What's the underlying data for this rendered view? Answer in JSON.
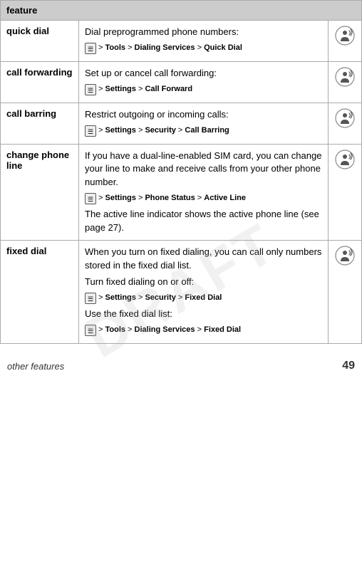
{
  "table": {
    "header": "feature",
    "rows": [
      {
        "feature": "quick dial",
        "description_text": "Dial preprogrammed phone numbers:",
        "menu_lines": [
          {
            "path": "> Tools > Dialing Services > Quick Dial"
          }
        ],
        "note": "",
        "has_icon": true
      },
      {
        "feature": "call forwarding",
        "description_text": "Set up or cancel call forwarding:",
        "menu_lines": [
          {
            "path": "> Settings > Call Forward"
          }
        ],
        "note": "",
        "has_icon": true
      },
      {
        "feature": "call barring",
        "description_text": "Restrict outgoing or incoming calls:",
        "menu_lines": [
          {
            "path": "> Settings > Security > Call Barring"
          }
        ],
        "note": "",
        "has_icon": true
      },
      {
        "feature": "change phone line",
        "description_text": "If you have a dual-line-enabled SIM card, you can change your line to make and receive calls from your other phone number.",
        "menu_lines": [
          {
            "path": "> Settings > Phone Status > Active Line"
          }
        ],
        "note": "The active line indicator shows the active phone line (see page 27).",
        "has_icon": true
      },
      {
        "feature": "fixed dial",
        "description_text": "When you turn on fixed dialing, you can call only numbers stored in the fixed dial list.",
        "menu_lines": [
          {
            "prefix": "Turn fixed dialing on or off:",
            "path": "> Settings > Security > Fixed Dial"
          },
          {
            "prefix": "Use the fixed dial list:",
            "path": "> Tools > Dialing Services > Fixed Dial"
          }
        ],
        "note": "",
        "has_icon": true
      }
    ]
  },
  "footer": {
    "left_text": "other features",
    "right_text": "49"
  },
  "watermark": "DRAFT"
}
